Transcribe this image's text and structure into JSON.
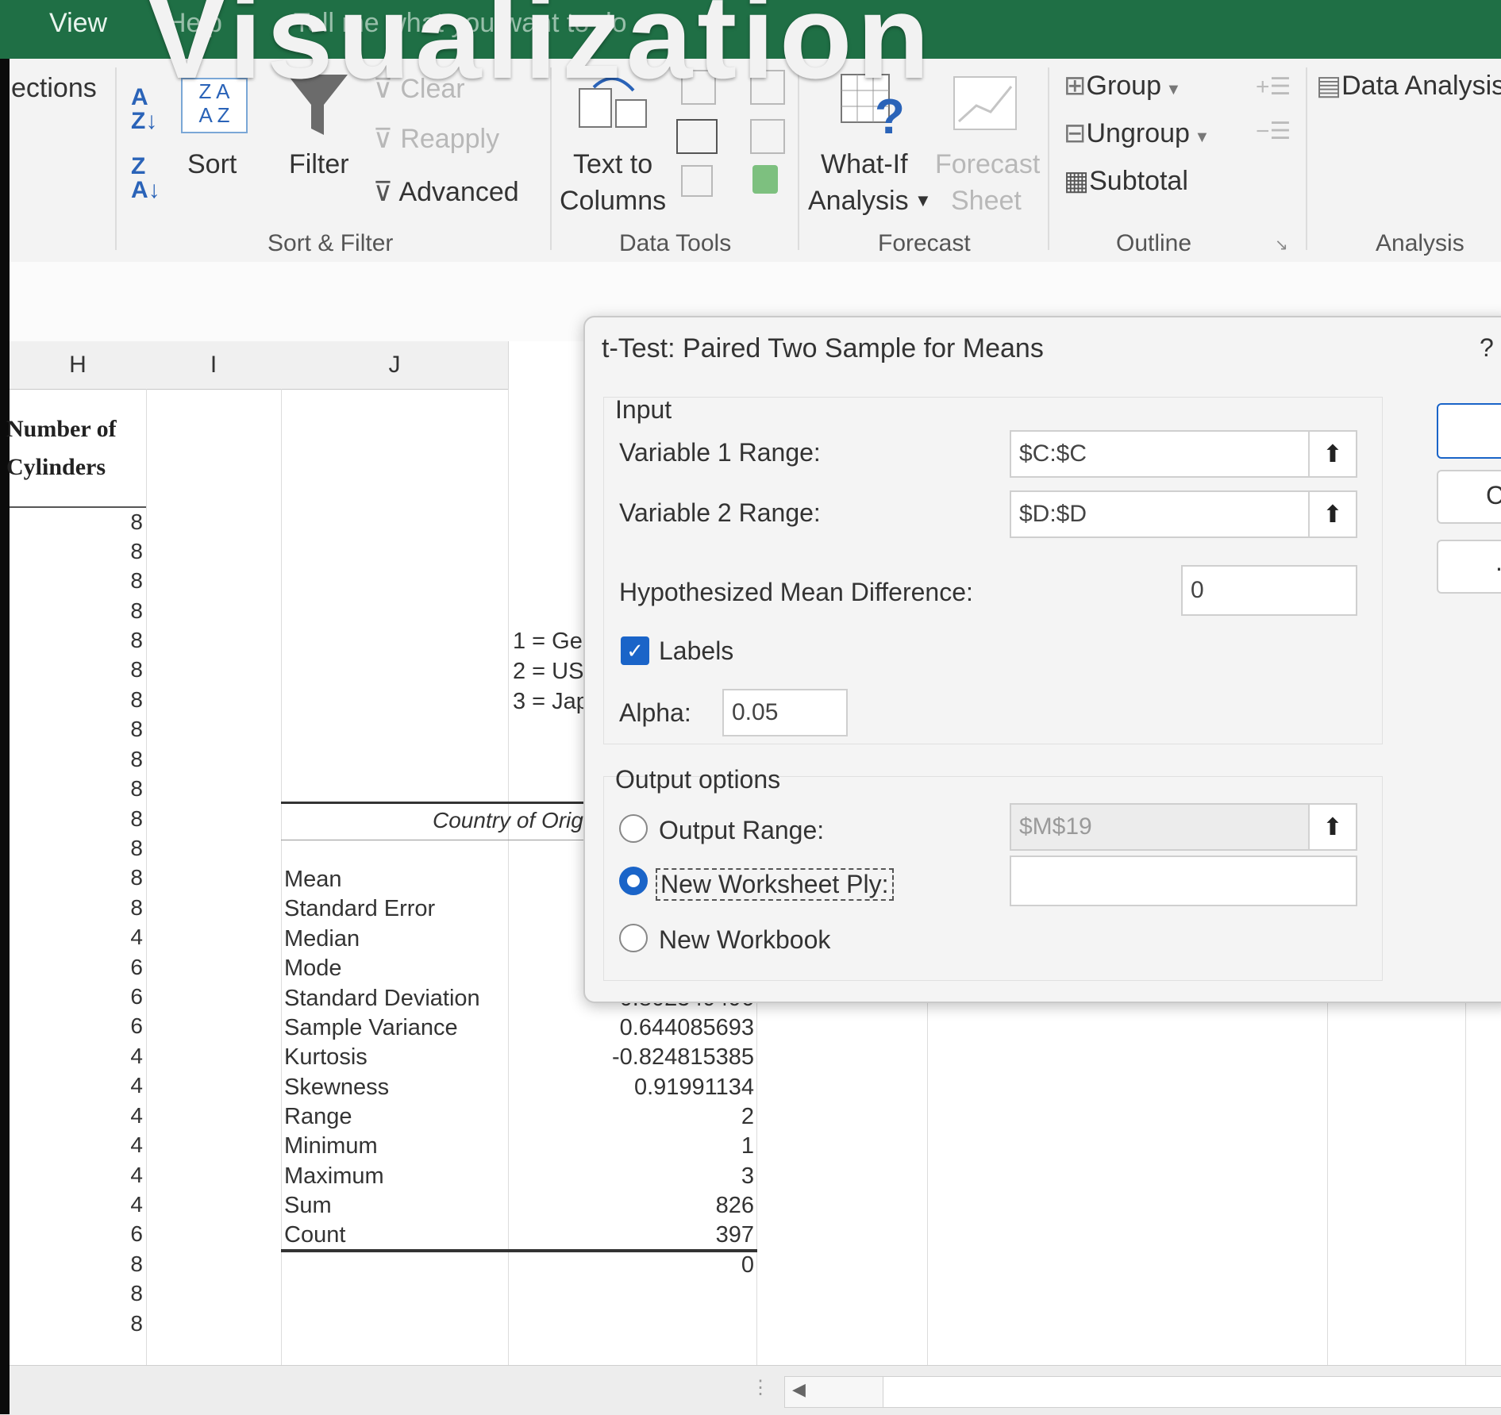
{
  "overlay": {
    "title": "Visualization"
  },
  "tabs": {
    "view": "View",
    "help": "Help",
    "tell_me": "Tell me what you want to do"
  },
  "ribbon": {
    "connections_fragment": "ections",
    "sort_label": "Sort",
    "filter_label": "Filter",
    "clear_label": "Clear",
    "reapply_label": "Reapply",
    "advanced_label": "Advanced",
    "sort_filter_group": "Sort & Filter",
    "text_to_columns_line1": "Text to",
    "text_to_columns_line2": "Columns",
    "data_tools_group": "Data Tools",
    "what_if_line1": "What-If",
    "what_if_line2": "Analysis",
    "forecast_sheet_line1": "Forecast",
    "forecast_sheet_line2": "Sheet",
    "forecast_group": "Forecast",
    "group_label": "Group",
    "ungroup_label": "Ungroup",
    "subtotal_label": "Subtotal",
    "outline_group": "Outline",
    "data_analysis_label": "Data Analysis",
    "analysis_group": "Analysis"
  },
  "sheet": {
    "columns": [
      "H",
      "I",
      "J"
    ],
    "header_line1": "Number of",
    "header_line2": "Cylinders",
    "cylinders": [
      "8",
      "8",
      "8",
      "8",
      "8",
      "8",
      "8",
      "8",
      "8",
      "8",
      "8",
      "8",
      "8",
      "8",
      "4",
      "6",
      "6",
      "6",
      "4",
      "4",
      "4",
      "4",
      "4",
      "4",
      "6",
      "8",
      "8",
      "8"
    ],
    "legend": [
      "1 = Ge",
      "2 = US",
      "3 = Jap"
    ],
    "country_header": "Country of Orig",
    "stats_labels": [
      "Mean",
      "Standard Error",
      "Median",
      "Mode",
      "Standard Deviation",
      "Sample Variance",
      "Kurtosis",
      "Skewness",
      "Range",
      "Minimum",
      "Maximum",
      "Sum",
      "Count"
    ],
    "stats_values": [
      "",
      "",
      "",
      "",
      "0.802549496",
      "0.644085693",
      "-0.824815385",
      "0.91991134",
      "2",
      "1",
      "3",
      "826",
      "397"
    ],
    "trailing_value": "0"
  },
  "dialog": {
    "title": "t-Test: Paired Two Sample for Means",
    "help": "?",
    "input_section": "Input",
    "var1_label": "Variable 1 Range:",
    "var1_value": "$C:$C",
    "var2_label": "Variable 2 Range:",
    "var2_value": "$D:$D",
    "hyp_label": "Hypothesized Mean Difference:",
    "hyp_value": "0",
    "labels_label": "Labels",
    "labels_checked": true,
    "alpha_label": "Alpha:",
    "alpha_value": "0.05",
    "output_section": "Output options",
    "output_range_label": "Output Range:",
    "output_range_value": "$M$19",
    "new_ply_label": "New Worksheet Ply:",
    "new_ply_value": "",
    "new_workbook_label": "New Workbook",
    "selected_output": "New Worksheet Ply",
    "side_button_2_fragment": "C",
    "side_button_3_fragment": "."
  },
  "colors": {
    "accent": "#1f6f45",
    "checkbox": "#1a64c8"
  }
}
